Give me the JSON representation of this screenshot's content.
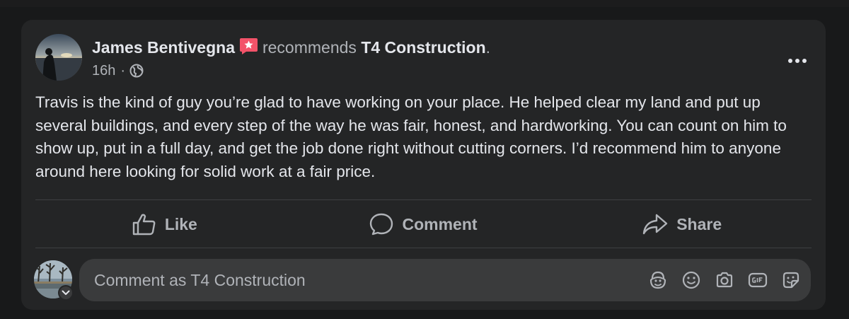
{
  "post": {
    "author": "James Bentivegna",
    "action_text": "recommends",
    "page_name": "T4 Construction",
    "trailing_punct": ".",
    "time": "16h",
    "separator": "·",
    "body": "Travis is the kind of guy you’re glad to have working on your place. He helped clear my land and put up several buildings, and every step of the way he was fair, honest, and hardworking. You can count on him to show up, put in a full day, and get the job done right without cutting corners. I’d recommend him to anyone around here looking for solid work at a fair price."
  },
  "actions": {
    "like": "Like",
    "comment": "Comment",
    "share": "Share"
  },
  "comment_box": {
    "placeholder": "Comment as T4 Construction"
  },
  "icons": {
    "recommend_badge": "recommend-star-icon",
    "privacy": "globe-icon",
    "more": "more-dots-icon",
    "like": "thumbs-up-icon",
    "comment": "comment-bubble-icon",
    "share": "share-arrow-icon",
    "avatar_sticker": "avatar-sticker-icon",
    "emoji": "emoji-icon",
    "camera": "camera-icon",
    "gif": "gif-icon",
    "sticker": "sticker-icon"
  },
  "colors": {
    "card_bg": "#242526",
    "page_bg": "#18191a",
    "text_primary": "#e4e6eb",
    "text_secondary": "#b0b3b8",
    "badge_pink": "#f35369"
  }
}
